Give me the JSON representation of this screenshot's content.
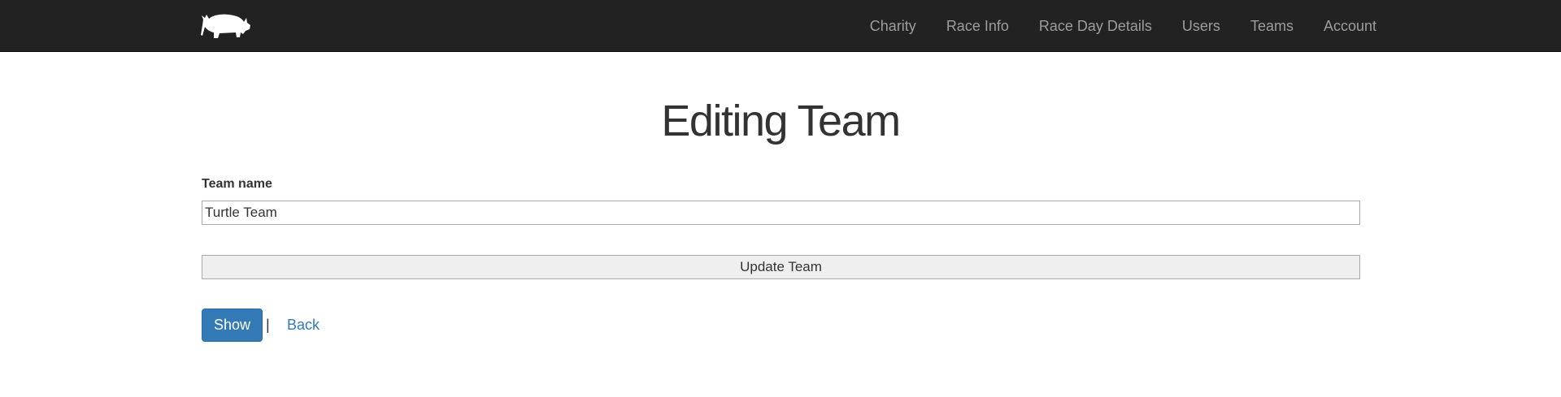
{
  "navbar": {
    "logo_icon": "rhino-logo-icon",
    "background_color": "#222222",
    "link_color": "#9d9d9d",
    "links": [
      {
        "label": "Charity"
      },
      {
        "label": "Race Info"
      },
      {
        "label": "Race Day Details"
      },
      {
        "label": "Users"
      },
      {
        "label": "Teams"
      },
      {
        "label": "Account"
      }
    ]
  },
  "page": {
    "title": "Editing Team"
  },
  "form": {
    "team_name_label": "Team name",
    "team_name_value": "Turtle Team",
    "submit_label": "Update Team"
  },
  "actions": {
    "show_label": "Show",
    "separator": "|",
    "back_label": "Back",
    "primary_color": "#337ab7"
  }
}
